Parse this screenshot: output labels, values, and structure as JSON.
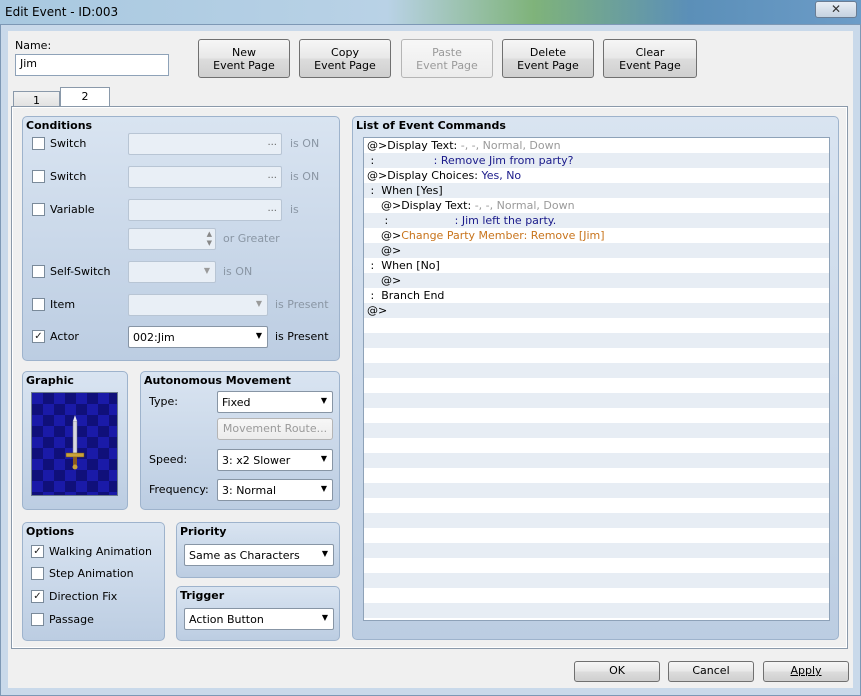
{
  "window": {
    "title": "Edit Event - ID:003",
    "close_label": "✕"
  },
  "name": {
    "label": "Name:",
    "value": "Jim"
  },
  "toolbar": [
    {
      "line1": "New",
      "line2": "Event Page",
      "enabled": true
    },
    {
      "line1": "Copy",
      "line2": "Event Page",
      "enabled": true
    },
    {
      "line1": "Paste",
      "line2": "Event Page",
      "enabled": false
    },
    {
      "line1": "Delete",
      "line2": "Event Page",
      "enabled": true
    },
    {
      "line1": "Clear",
      "line2": "Event Page",
      "enabled": true
    }
  ],
  "tabs": [
    {
      "label": "1"
    },
    {
      "label": "2"
    }
  ],
  "conditions": {
    "title": "Conditions",
    "switch1": {
      "label": "Switch",
      "checked": false,
      "suffix": "is ON",
      "dots": "..."
    },
    "switch2": {
      "label": "Switch",
      "checked": false,
      "suffix": "is ON",
      "dots": "..."
    },
    "variable": {
      "label": "Variable",
      "checked": false,
      "suffix": "is",
      "dots": "...",
      "suffix2": "or Greater"
    },
    "self_switch": {
      "label": "Self-Switch",
      "checked": false,
      "suffix": "is ON"
    },
    "item": {
      "label": "Item",
      "checked": false,
      "suffix": "is Present"
    },
    "actor": {
      "label": "Actor",
      "checked": true,
      "value": "002:Jim",
      "suffix": "is Present"
    }
  },
  "graphic": {
    "title": "Graphic"
  },
  "autonomous": {
    "title": "Autonomous Movement",
    "type_label": "Type:",
    "type_value": "Fixed",
    "route_button": "Movement Route...",
    "speed_label": "Speed:",
    "speed_value": "3: x2 Slower",
    "frequency_label": "Frequency:",
    "frequency_value": "3: Normal"
  },
  "options": {
    "title": "Options",
    "items": [
      {
        "label": "Walking Animation",
        "checked": true
      },
      {
        "label": "Step Animation",
        "checked": false
      },
      {
        "label": "Direction Fix",
        "checked": true
      },
      {
        "label": "Passage",
        "checked": false
      }
    ]
  },
  "priority": {
    "title": "Priority",
    "value": "Same as Characters"
  },
  "trigger": {
    "title": "Trigger",
    "value": "Action Button"
  },
  "command_list": {
    "title": "List of Event Commands",
    "rows": [
      [
        {
          "t": "@>Display Text: ",
          "c": "black"
        },
        {
          "t": "-, -, Normal, Down",
          "c": "gray"
        }
      ],
      [
        {
          "t": " :                 ",
          "c": "black"
        },
        {
          "t": ": Remove Jim from party?",
          "c": "blue"
        }
      ],
      [
        {
          "t": "@>Display Choices: ",
          "c": "black"
        },
        {
          "t": "Yes, No",
          "c": "blue"
        }
      ],
      [
        {
          "t": " :  When [Yes]",
          "c": "black"
        }
      ],
      [
        {
          "t": "    @>Display Text: ",
          "c": "black"
        },
        {
          "t": "-, -, Normal, Down",
          "c": "gray"
        }
      ],
      [
        {
          "t": "     :                   ",
          "c": "black"
        },
        {
          "t": ": Jim left the party.",
          "c": "blue"
        }
      ],
      [
        {
          "t": "    @>",
          "c": "black"
        },
        {
          "t": "Change Party Member: Remove [Jim]",
          "c": "orange"
        }
      ],
      [
        {
          "t": "    @>",
          "c": "black"
        }
      ],
      [
        {
          "t": " :  When [No]",
          "c": "black"
        }
      ],
      [
        {
          "t": "    @>",
          "c": "black"
        }
      ],
      [
        {
          "t": " :  Branch End",
          "c": "black"
        }
      ],
      [
        {
          "t": "@>",
          "c": "black"
        }
      ]
    ]
  },
  "footer": {
    "ok": "OK",
    "cancel": "Cancel",
    "apply": "Apply"
  }
}
